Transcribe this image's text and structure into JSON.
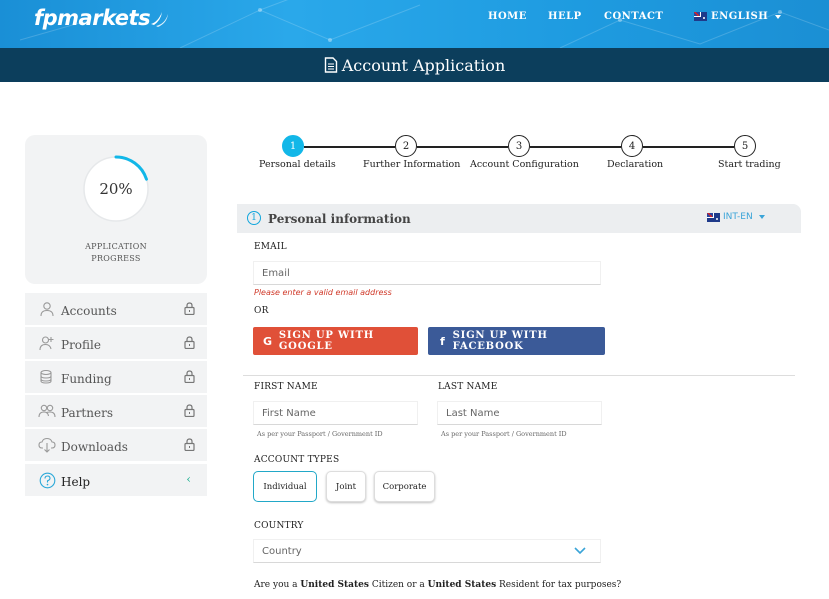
{
  "header": {
    "logo": "fpmarkets",
    "nav": {
      "home": "HOME",
      "help": "HELP",
      "contact": "CONTACT"
    },
    "language": "ENGLISH",
    "page_title": "Account Application"
  },
  "progress": {
    "percent_label": "20%",
    "value": 0.2,
    "label_line1": "APPLICATION",
    "label_line2": "PROGRESS"
  },
  "sidebar": {
    "items": [
      {
        "label": "Accounts",
        "icon": "user-icon",
        "locked": true
      },
      {
        "label": "Profile",
        "icon": "user-plus-icon",
        "locked": true
      },
      {
        "label": "Funding",
        "icon": "coins-icon",
        "locked": true
      },
      {
        "label": "Partners",
        "icon": "users-icon",
        "locked": true
      },
      {
        "label": "Downloads",
        "icon": "cloud-download-icon",
        "locked": true
      },
      {
        "label": "Help",
        "icon": "help-icon",
        "locked": false
      }
    ]
  },
  "stepper": {
    "steps": [
      {
        "num": "1",
        "label": "Personal details",
        "active": true
      },
      {
        "num": "2",
        "label": "Further Information",
        "active": false
      },
      {
        "num": "3",
        "label": "Account Configuration",
        "active": false
      },
      {
        "num": "4",
        "label": "Declaration",
        "active": false
      },
      {
        "num": "5",
        "label": "Start trading",
        "active": false
      }
    ]
  },
  "form": {
    "section_num": "1",
    "section_title": "Personal information",
    "locale": "INT-EN",
    "email_label": "EMAIL",
    "email_placeholder": "Email",
    "email_error": "Please enter a valid email address",
    "or_label": "OR",
    "google_button": "SIGN UP WITH GOOGLE",
    "facebook_button": "SIGN UP WITH FACEBOOK",
    "first_name_label": "FIRST NAME",
    "first_name_placeholder": "First Name",
    "last_name_label": "LAST NAME",
    "last_name_placeholder": "Last Name",
    "name_hint": "As per your Passport / Government ID",
    "account_types_label": "ACCOUNT TYPES",
    "account_types": [
      "Individual",
      "Joint",
      "Corporate"
    ],
    "account_type_selected": "Individual",
    "country_label": "COUNTRY",
    "country_placeholder": "Country",
    "question_parts": [
      "Are you a ",
      "United States",
      " Citizen or a ",
      "United States",
      " Resident for tax purposes?"
    ]
  },
  "colors": {
    "header_blue": "#1e9be0",
    "titlebar_navy": "#0c3e5c",
    "accent_cyan": "#12b7e8",
    "google_red": "#e05038",
    "facebook_blue": "#3b5a98",
    "error_red": "#d03a2a"
  }
}
